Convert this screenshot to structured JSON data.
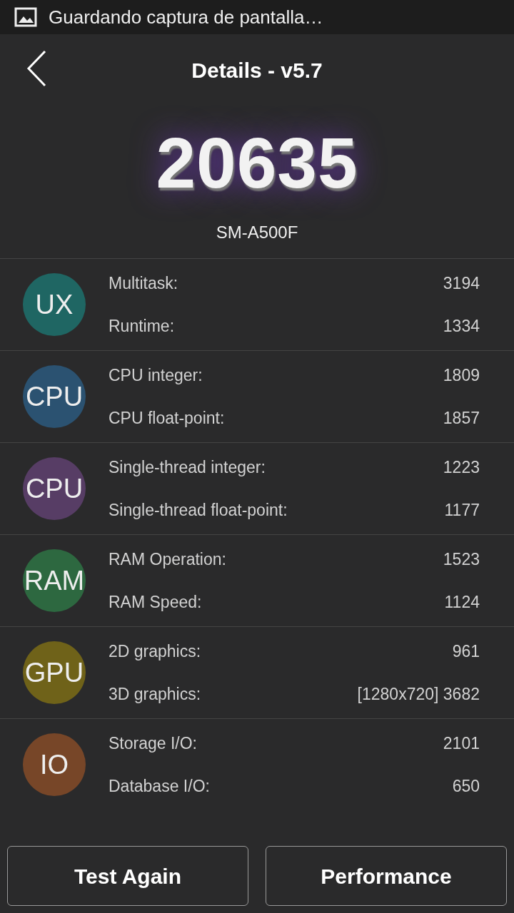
{
  "status_bar": {
    "notification": "Guardando captura de pantalla…"
  },
  "header": {
    "title": "Details - v5.7"
  },
  "score": {
    "value": "20635",
    "device": "SM-A500F"
  },
  "sections": [
    {
      "badge": "UX",
      "color": "#1f6663",
      "rows": [
        {
          "label": "Multitask:",
          "value": "3194"
        },
        {
          "label": "Runtime:",
          "value": "1334"
        }
      ]
    },
    {
      "badge": "CPU",
      "color": "#2b5271",
      "rows": [
        {
          "label": "CPU integer:",
          "value": "1809"
        },
        {
          "label": "CPU float-point:",
          "value": "1857"
        }
      ]
    },
    {
      "badge": "CPU",
      "color": "#573d65",
      "rows": [
        {
          "label": "Single-thread integer:",
          "value": "1223"
        },
        {
          "label": "Single-thread float-point:",
          "value": "1177"
        }
      ]
    },
    {
      "badge": "RAM",
      "color": "#2d6840",
      "rows": [
        {
          "label": "RAM Operation:",
          "value": "1523"
        },
        {
          "label": "RAM Speed:",
          "value": "1124"
        }
      ]
    },
    {
      "badge": "GPU",
      "color": "#6f6219",
      "rows": [
        {
          "label": "2D graphics:",
          "value": "961"
        },
        {
          "label": "3D graphics:",
          "value": "[1280x720] 3682"
        }
      ]
    },
    {
      "badge": "IO",
      "color": "#774628",
      "rows": [
        {
          "label": "Storage I/O:",
          "value": "2101"
        },
        {
          "label": "Database I/O:",
          "value": "650"
        }
      ]
    }
  ],
  "buttons": [
    "Test Again",
    "Performance"
  ]
}
